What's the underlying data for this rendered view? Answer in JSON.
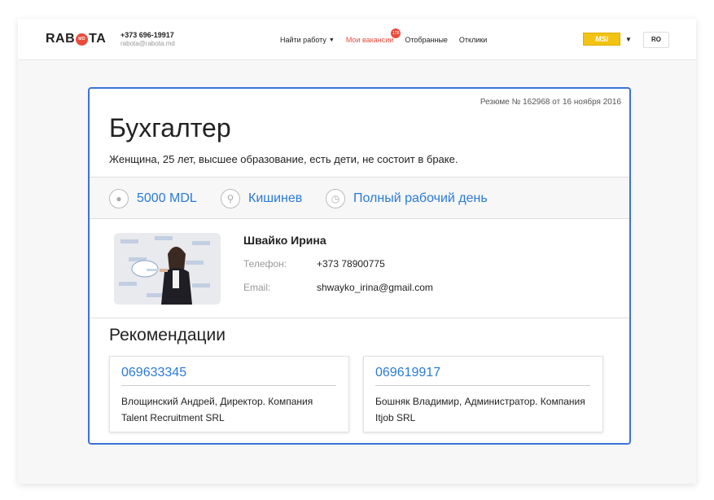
{
  "header": {
    "logo_left": "RAB",
    "logo_dot": "MD",
    "logo_right": "TA",
    "phone": "+373 696-19917",
    "email": "rabota@rabota.md",
    "nav": [
      {
        "label": "Найти работу"
      },
      {
        "label": "Мои вакансии",
        "badge": "176"
      },
      {
        "label": "Отобранные"
      },
      {
        "label": "Отклики"
      }
    ],
    "msi_label": "MSI",
    "lang": "RO"
  },
  "resume": {
    "number_text": "Резюме № 162968 от 16 ноября 2016",
    "title": "Бухгалтер",
    "subtitle": "Женщина, 25 лет, высшее образование, есть дети, не состоит в браке.",
    "salary": "5000 MDL",
    "city": "Кишинев",
    "schedule": "Полный рабочий день",
    "name": "Швайко Ирина",
    "phone_label": "Телефон:",
    "phone": "+373 78900775",
    "email_label": "Email:",
    "email": "shwayko_irina@gmail.com",
    "recommendations_title": "Рекомендации",
    "recommendations": [
      {
        "phone": "069633345",
        "text": "Влощинский Андрей, Директор. Компания Talent Recruitment SRL"
      },
      {
        "phone": "069619917",
        "text": "Бошняк Владимир, Администратор. Компания Itjob SRL"
      }
    ]
  },
  "colors": {
    "accent": "#2a7ad9",
    "brand": "#e84c3d",
    "border": "#3b72d9"
  }
}
